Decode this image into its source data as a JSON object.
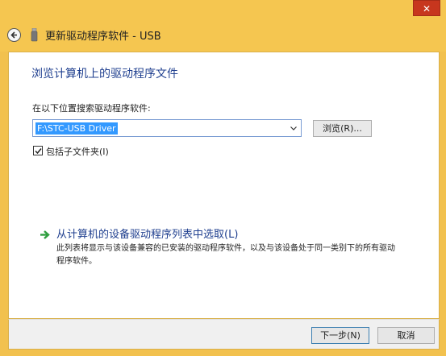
{
  "window": {
    "title": "更新驱动程序软件 - USB",
    "close_label": "✕"
  },
  "page": {
    "heading": "浏览计算机上的驱动程序文件",
    "search_label": "在以下位置搜索驱动程序软件:",
    "path_value": "F:\\STC-USB Driver",
    "browse_label": "浏览(R)...",
    "include_subfolders_label": "包括子文件夹(I)",
    "include_subfolders_checked": true,
    "pick_link": "从计算机的设备驱动程序列表中选取(L)",
    "pick_description": "此列表将显示与该设备兼容的已安装的驱动程序软件，以及与该设备处于同一类别下的所有驱动程序软件。"
  },
  "footer": {
    "next_label": "下一步(N)",
    "cancel_label": "取消"
  },
  "colors": {
    "frame": "#f2c14e",
    "heading_blue": "#1f3f8f",
    "selection_blue": "#3399ff",
    "arrow_green": "#2e9e3e",
    "close_red": "#c7361e"
  },
  "icons": {
    "back": "back-arrow-icon",
    "device": "usb-device-icon",
    "dropdown": "chevron-down-icon",
    "check": "check-icon",
    "link_arrow": "green-arrow-icon"
  }
}
